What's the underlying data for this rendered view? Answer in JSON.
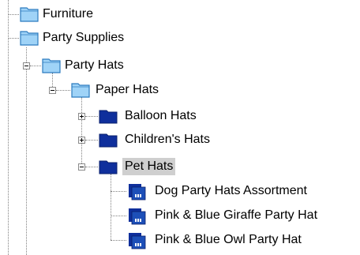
{
  "tree": {
    "nodes": [
      {
        "label": "Furniture",
        "icon": "folder-light-icon",
        "expander": "none"
      },
      {
        "label": "Party Supplies",
        "icon": "folder-light-icon",
        "expander": "none"
      },
      {
        "label": "Party Hats",
        "icon": "folder-light-icon",
        "expander": "minus"
      },
      {
        "label": "Paper Hats",
        "icon": "folder-light-icon",
        "expander": "minus"
      },
      {
        "label": "Balloon Hats",
        "icon": "folder-dark-icon",
        "expander": "plus"
      },
      {
        "label": "Children's Hats",
        "icon": "folder-dark-icon",
        "expander": "plus"
      },
      {
        "label": "Pet Hats",
        "icon": "folder-dark-icon",
        "expander": "minus",
        "selected": true
      },
      {
        "label": "Dog Party Hats Assortment",
        "icon": "product-icon",
        "expander": "none"
      },
      {
        "label": "Pink & Blue Giraffe Party Hat",
        "icon": "product-icon",
        "expander": "none"
      },
      {
        "label": "Pink & Blue Owl Party Hat",
        "icon": "product-icon",
        "expander": "none"
      }
    ]
  },
  "colors": {
    "folder_light": "#9fd3f7",
    "folder_light_border": "#2c7bbf",
    "folder_dark": "#0f2f9c",
    "product_blue": "#1d4fb8",
    "selection": "#cfcfcf"
  }
}
